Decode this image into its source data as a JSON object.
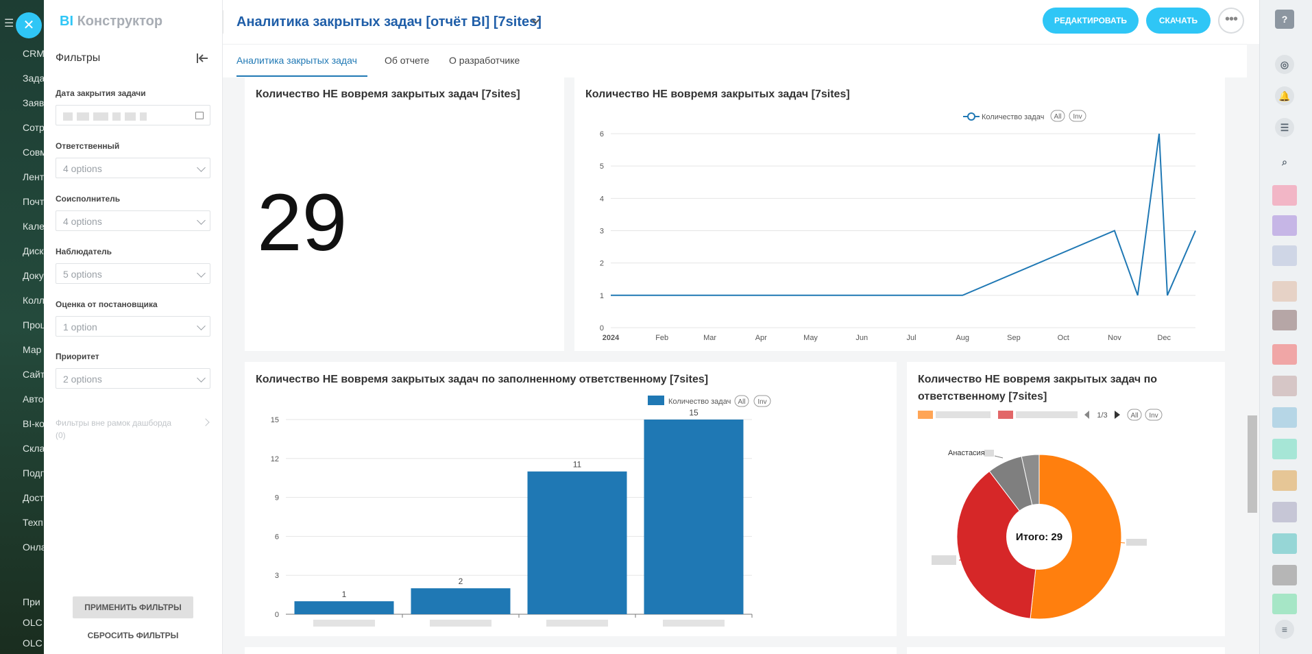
{
  "left_menu": [
    "CRM",
    "Зада",
    "Заяв",
    "Сотр",
    "Совм",
    "Лент",
    "Почт",
    "Кале",
    "Диск",
    "Доку",
    "Колл",
    "Проц",
    "Мар",
    "Сайт",
    "Авто",
    "BI-ко",
    "Скла",
    "Подп",
    "Дост",
    "Техп",
    "Онла",
    "При",
    "OLC",
    "OLC"
  ],
  "app": {
    "logo_bi": "BI",
    "logo_text": "Конструктор"
  },
  "filters": {
    "title": "Фильтры",
    "date_label": "Дата закрытия задачи",
    "responsible_label": "Ответственный",
    "responsible_value": "4 options",
    "coexecutor_label": "Соисполнитель",
    "coexecutor_value": "4 options",
    "observer_label": "Наблюдатель",
    "observer_value": "5 options",
    "rating_label": "Оценка от постановщика",
    "rating_value": "1 option",
    "priority_label": "Приоритет",
    "priority_value": "2 options",
    "outside_label": "Фильтры вне рамок дашборда",
    "outside_count": "(0)",
    "apply": "ПРИМЕНИТЬ ФИЛЬТРЫ",
    "reset": "СБРОСИТЬ ФИЛЬТРЫ"
  },
  "header": {
    "title": "Аналитика закрытых задач [отчёт BI] [7sites]",
    "edit": "РЕДАКТИРОВАТЬ",
    "download": "СКАЧАТЬ",
    "more": "•••"
  },
  "tabs": [
    "Аналитика закрытых задач",
    "Об отчете",
    "О разработчике"
  ],
  "cards": {
    "big_number": {
      "title": "Количество НЕ вовремя закрытых задач [7sites]",
      "value": "29"
    },
    "line": {
      "title": "Количество НЕ вовремя закрытых задач [7sites]",
      "legend": "Количество задач",
      "all": "All",
      "inv": "Inv"
    },
    "bar": {
      "title": "Количество НЕ вовремя закрытых задач по заполненному ответственному [7sites]",
      "legend": "Количество задач",
      "all": "All",
      "inv": "Inv"
    },
    "pie": {
      "title_line1": "Количество НЕ вовремя закрытых задач по",
      "title_line2": "ответственному [7sites]",
      "pager": "1/3",
      "all": "All",
      "inv": "Inv",
      "center": "Итого: 29",
      "label_named": "Анастасия"
    }
  },
  "chart_data": [
    {
      "type": "line",
      "title": "Количество НЕ вовремя закрытых задач [7sites]",
      "series": [
        {
          "name": "Количество задач",
          "points": [
            [
              "2024-01-01",
              1
            ],
            [
              "2024-08-01",
              1
            ],
            [
              "2024-11-01",
              3
            ],
            [
              "2024-11-15",
              1
            ],
            [
              "2024-11-28",
              6
            ],
            [
              "2024-12-03",
              1
            ],
            [
              "2024-12-20",
              3
            ]
          ]
        }
      ],
      "x_ticks": [
        "2024",
        "Feb",
        "Mar",
        "Apr",
        "May",
        "Jun",
        "Jul",
        "Aug",
        "Sep",
        "Oct",
        "Nov",
        "Dec"
      ],
      "y_ticks": [
        0,
        1,
        2,
        3,
        4,
        5,
        6
      ],
      "ylim": [
        0,
        6
      ],
      "grid": true,
      "color": "#1f78b4"
    },
    {
      "type": "bar",
      "title": "Количество НЕ вовремя закрытых задач по заполненному ответственному [7sites]",
      "values": [
        1,
        2,
        11,
        15
      ],
      "y_ticks": [
        0,
        3,
        6,
        9,
        12,
        15
      ],
      "ylim": [
        0,
        15
      ],
      "series_name": "Количество задач",
      "color": "#1f78b4"
    },
    {
      "type": "pie",
      "title": "Количество НЕ вовремя закрытых задач по ответственному [7sites]",
      "values": [
        15,
        11,
        2,
        1
      ],
      "colors": [
        "#ff7f0e",
        "#d62728",
        "#7f7f7f",
        "#8c8c8c"
      ],
      "center_label": "Итого: 29"
    }
  ]
}
